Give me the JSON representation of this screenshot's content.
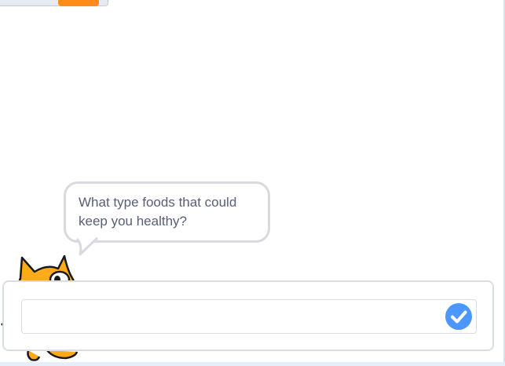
{
  "stage": {
    "background": "#ffffff"
  },
  "monitor": {
    "label": "",
    "value": ""
  },
  "speech_bubble": {
    "text": "What type foods that could keep you healthy?"
  },
  "ask_prompt": {
    "input_value": "",
    "placeholder": "",
    "submit_icon": "checkmark-icon",
    "accent_color": "#4c97ff"
  },
  "sprite": {
    "name": "cat-sprite",
    "color": "#ffab19"
  }
}
